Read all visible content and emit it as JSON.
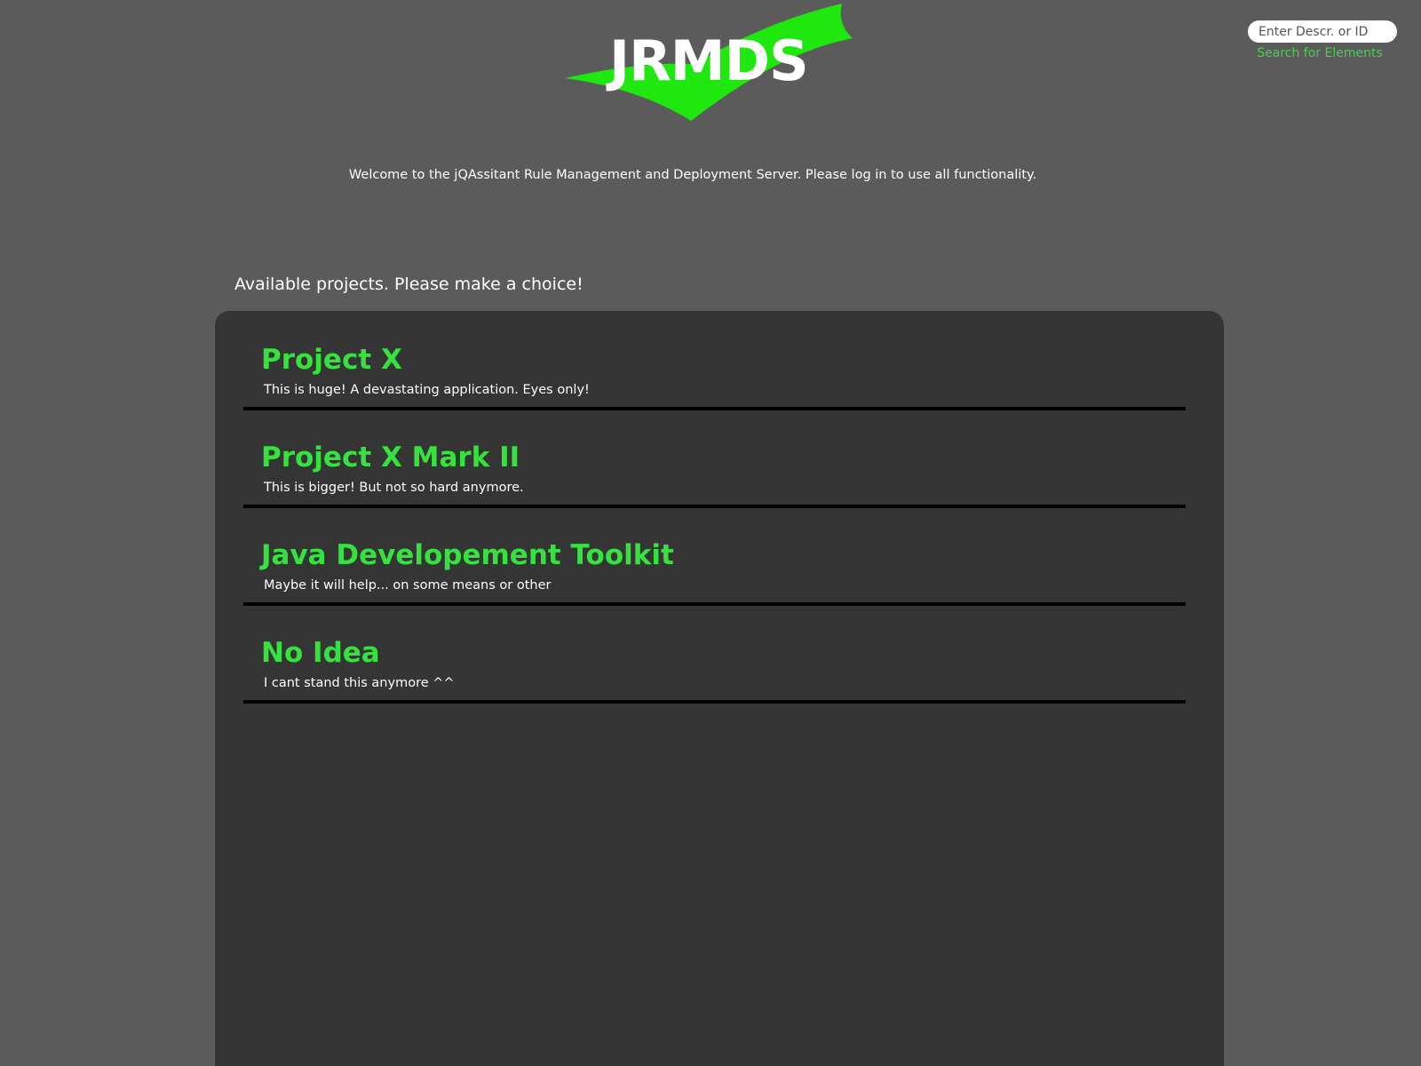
{
  "header": {
    "logo_text": "JRMDS",
    "accent_color": "#1fe80f"
  },
  "search": {
    "placeholder": "Enter Descr. or ID",
    "value": "",
    "link_label": "Search for Elements"
  },
  "welcome_message": "Welcome to the jQAssitant Rule Management and Deployment Server. Please log in to use all functionality.",
  "projects_heading": "Available projects. Please make a choice!",
  "projects": [
    {
      "title": "Project X",
      "description": "This is huge! A devastating application. Eyes only!"
    },
    {
      "title": "Project X Mark II",
      "description": "This is bigger! But not so hard anymore."
    },
    {
      "title": "Java Developement Toolkit",
      "description": "Maybe it will help... on some means or other"
    },
    {
      "title": "No Idea",
      "description": "I cant stand this anymore ^^"
    }
  ],
  "colors": {
    "background": "#5b5b5b",
    "panel": "#353535",
    "project_title": "#35e23e",
    "link": "#4ecb55"
  }
}
